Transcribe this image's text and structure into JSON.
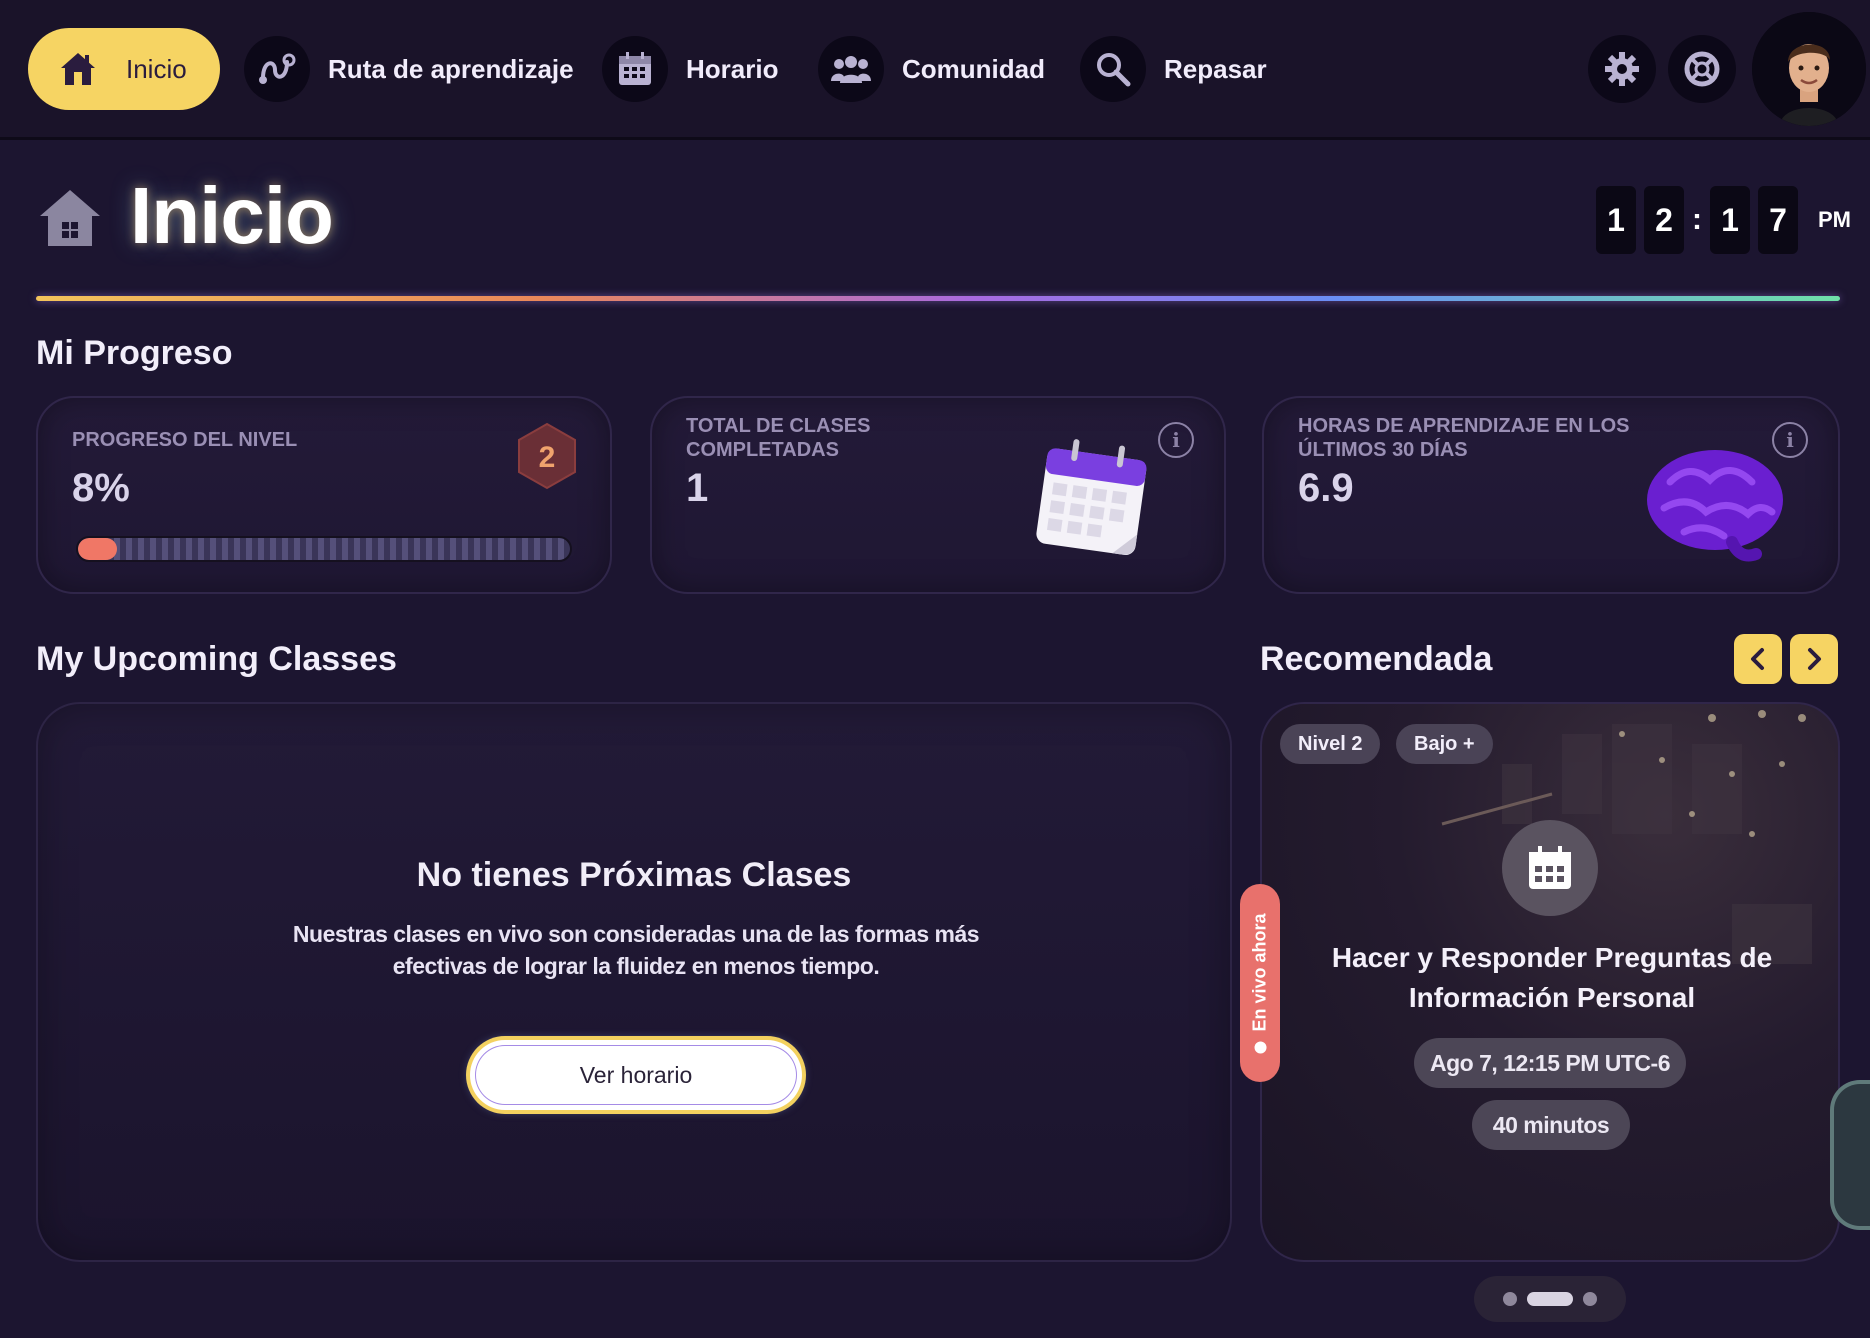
{
  "nav": {
    "home_label": "Inicio",
    "items": [
      {
        "label": "Ruta de aprendizaje",
        "icon": "route-icon"
      },
      {
        "label": "Horario",
        "icon": "calendar-icon"
      },
      {
        "label": "Comunidad",
        "icon": "community-icon"
      },
      {
        "label": "Repasar",
        "icon": "search-icon"
      }
    ],
    "settings_icon": "gear-icon",
    "help_icon": "lifebuoy-icon"
  },
  "header": {
    "title": "Inicio",
    "clock": {
      "h1": "1",
      "h2": "2",
      "m1": "1",
      "m2": "7",
      "ampm": "PM"
    }
  },
  "progress": {
    "section_title": "Mi Progreso",
    "level": {
      "label": "PROGRESO DEL NIVEL",
      "value": "8%",
      "percent": 8,
      "badge": "2"
    },
    "classes": {
      "label_line1": "TOTAL DE CLASES",
      "label_line2": "COMPLETADAS",
      "value": "1"
    },
    "hours": {
      "label_line1": "HORAS DE APRENDIZAJE EN LOS",
      "label_line2": "ÚLTIMOS 30 DÍAS",
      "value": "6.9"
    }
  },
  "upcoming": {
    "section_title": "My Upcoming Classes",
    "empty_title": "No tienes Próximas Clases",
    "empty_text_line1": "Nuestras clases en vivo son consideradas una de las formas más",
    "empty_text_line2": "efectivas de lograr la fluidez en menos tiempo.",
    "button_label": "Ver horario"
  },
  "recommended": {
    "section_title": "Recomendada",
    "chips": [
      "Nivel 2",
      "Bajo +"
    ],
    "live_label": "En vivo ahora",
    "class_title_line1": "Hacer y Responder Preguntas de",
    "class_title_line2": "Información Personal",
    "datetime": "Ago 7, 12:15 PM UTC-6",
    "duration": "40 minutos"
  },
  "colors": {
    "background": "#1c1530",
    "accent_yellow": "#f6d463",
    "progress_fill": "#f07766",
    "live_red": "#e8716c"
  }
}
